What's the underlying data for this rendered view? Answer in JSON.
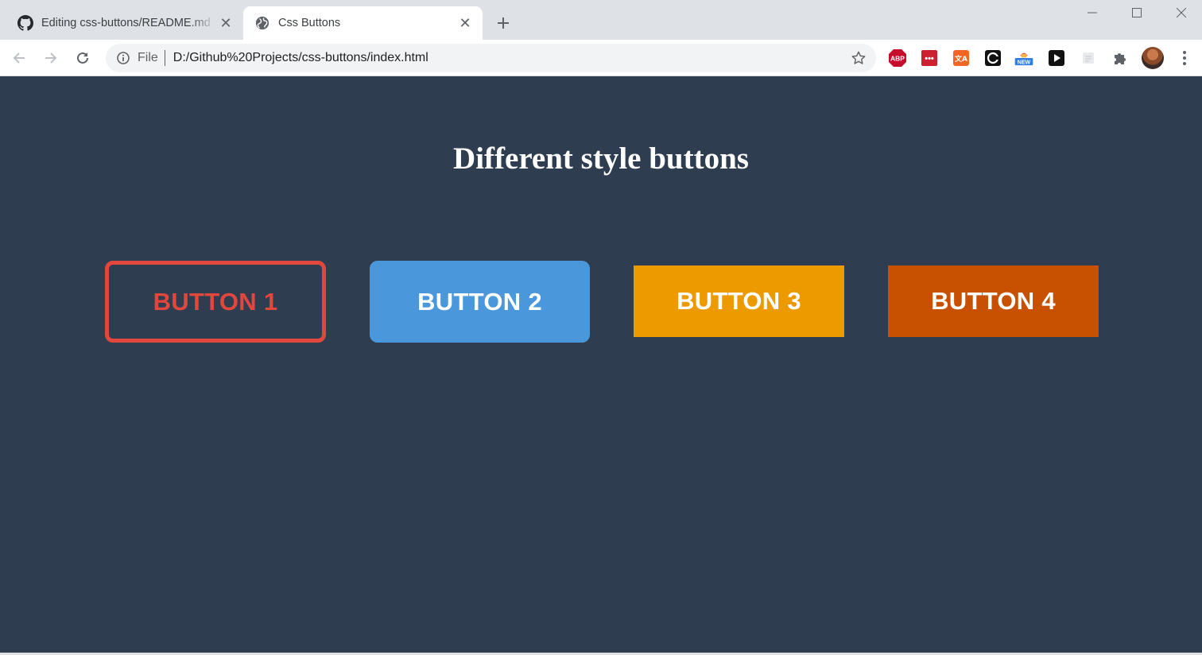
{
  "browser": {
    "tabs": [
      {
        "title": "Editing css-buttons/README.md",
        "favicon": "github-icon",
        "active": false
      },
      {
        "title": "Css Buttons",
        "favicon": "globe-icon",
        "active": true
      }
    ],
    "address": {
      "scheme_label": "File",
      "url": "D:/Github%20Projects/css-buttons/index.html"
    },
    "extensions": [
      {
        "name": "adblock-plus-icon",
        "label": "ABP"
      },
      {
        "name": "lastpass-icon",
        "label": "•••"
      },
      {
        "name": "translate-icon",
        "label": "文A"
      },
      {
        "name": "c-extension-icon",
        "label": "C"
      },
      {
        "name": "new-extension-icon",
        "label": "NEW"
      },
      {
        "name": "play-icon",
        "label": ""
      },
      {
        "name": "document-icon",
        "label": ""
      },
      {
        "name": "extensions-puzzle-icon",
        "label": ""
      }
    ]
  },
  "page": {
    "heading": "Different style buttons",
    "buttons": [
      {
        "label": "BUTTON 1",
        "style": "outline",
        "color": "#e1473d"
      },
      {
        "label": "BUTTON 2",
        "style": "rounded-fill",
        "color": "#4a98db"
      },
      {
        "label": "BUTTON 3",
        "style": "square-fill",
        "color": "#ec9a00"
      },
      {
        "label": "BUTTON 4",
        "style": "square-fill",
        "color": "#c75100"
      }
    ],
    "background_color": "#2f3d51"
  }
}
